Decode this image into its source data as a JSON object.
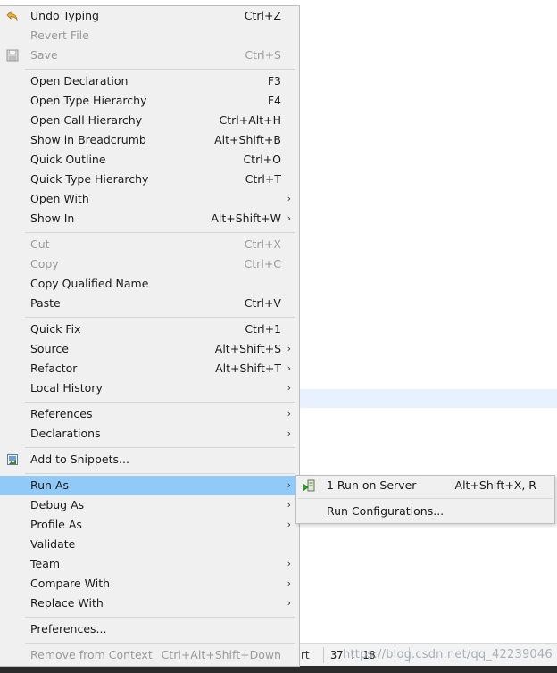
{
  "menu": {
    "items": [
      {
        "label": "Undo Typing",
        "shortcut": "Ctrl+Z",
        "icon": "undo-icon"
      },
      {
        "label": "Revert File",
        "shortcut": "",
        "disabled": true
      },
      {
        "label": "Save",
        "shortcut": "Ctrl+S",
        "disabled": true,
        "icon": "save-icon"
      },
      {
        "label": "Open Declaration",
        "shortcut": "F3"
      },
      {
        "label": "Open Type Hierarchy",
        "shortcut": "F4"
      },
      {
        "label": "Open Call Hierarchy",
        "shortcut": "Ctrl+Alt+H"
      },
      {
        "label": "Show in Breadcrumb",
        "shortcut": "Alt+Shift+B"
      },
      {
        "label": "Quick Outline",
        "shortcut": "Ctrl+O"
      },
      {
        "label": "Quick Type Hierarchy",
        "shortcut": "Ctrl+T"
      },
      {
        "label": "Open With",
        "shortcut": "",
        "submenu": true
      },
      {
        "label": "Show In",
        "shortcut": "Alt+Shift+W",
        "submenu": true
      },
      {
        "label": "Cut",
        "shortcut": "Ctrl+X",
        "disabled": true
      },
      {
        "label": "Copy",
        "shortcut": "Ctrl+C",
        "disabled": true
      },
      {
        "label": "Copy Qualified Name",
        "shortcut": ""
      },
      {
        "label": "Paste",
        "shortcut": "Ctrl+V"
      },
      {
        "label": "Quick Fix",
        "shortcut": "Ctrl+1"
      },
      {
        "label": "Source",
        "shortcut": "Alt+Shift+S",
        "submenu": true
      },
      {
        "label": "Refactor",
        "shortcut": "Alt+Shift+T",
        "submenu": true
      },
      {
        "label": "Local History",
        "shortcut": "",
        "submenu": true
      },
      {
        "label": "References",
        "shortcut": "",
        "submenu": true
      },
      {
        "label": "Declarations",
        "shortcut": "",
        "submenu": true
      },
      {
        "label": "Add to Snippets...",
        "shortcut": "",
        "icon": "snippets-icon"
      },
      {
        "label": "Run As",
        "shortcut": "",
        "submenu": true,
        "active": true
      },
      {
        "label": "Debug As",
        "shortcut": "",
        "submenu": true
      },
      {
        "label": "Profile As",
        "shortcut": "",
        "submenu": true
      },
      {
        "label": "Validate",
        "shortcut": ""
      },
      {
        "label": "Team",
        "shortcut": "",
        "submenu": true
      },
      {
        "label": "Compare With",
        "shortcut": "",
        "submenu": true
      },
      {
        "label": "Replace With",
        "shortcut": "",
        "submenu": true
      },
      {
        "label": "Preferences...",
        "shortcut": ""
      },
      {
        "label": "Remove from Context",
        "shortcut": "Ctrl+Alt+Shift+Down",
        "disabled": true
      }
    ],
    "submenu_arrow": "›"
  },
  "run_as_submenu": {
    "items": [
      {
        "label": "1 Run on Server",
        "shortcut": "Alt+Shift+X, R",
        "icon": "run-on-server-icon"
      },
      {
        "label": "Run Configurations...",
        "shortcut": ""
      }
    ]
  },
  "statusbar": {
    "fragment": "rt",
    "position": "37 : 18"
  },
  "watermark": "https://blog.csdn.net/qq_42239046",
  "colors": {
    "menu_bg": "#f0f0f0",
    "highlight": "#91c9f7",
    "disabled_text": "#9a9a9a",
    "current_line": "#e8f2fe"
  }
}
